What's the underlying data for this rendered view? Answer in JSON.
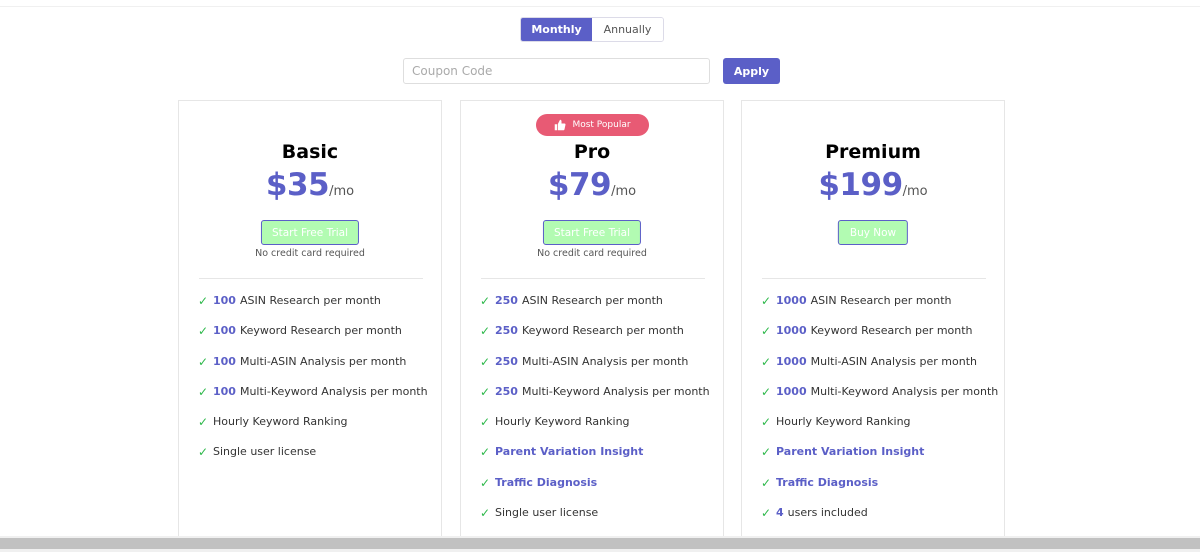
{
  "billing": {
    "options": [
      "Monthly",
      "Annually"
    ],
    "selected": "Monthly"
  },
  "coupon": {
    "placeholder": "Coupon Code",
    "value": "",
    "apply_label": "Apply"
  },
  "colors": {
    "accent": "#5b5fc7",
    "badge": "#e85a74",
    "cta_bg": "#b2fbb2",
    "check": "#2eb84b"
  },
  "plans": [
    {
      "name": "Basic",
      "price": "$35",
      "period": "/mo",
      "cta": "Start Free Trial",
      "note": "No credit card required",
      "features": [
        {
          "num": "100",
          "text": "ASIN Research per month",
          "highlight": false
        },
        {
          "num": "100",
          "text": "Keyword Research per month",
          "highlight": false
        },
        {
          "num": "100",
          "text": "Multi-ASIN Analysis per month",
          "highlight": false
        },
        {
          "num": "100",
          "text": "Multi-Keyword Analysis per month",
          "highlight": false
        },
        {
          "num": "",
          "text": "Hourly Keyword Ranking",
          "highlight": false
        },
        {
          "num": "",
          "text": "Single user license",
          "highlight": false
        }
      ]
    },
    {
      "name": "Pro",
      "badge": "Most Popular",
      "price": "$79",
      "period": "/mo",
      "cta": "Start Free Trial",
      "note": "No credit card required",
      "features": [
        {
          "num": "250",
          "text": "ASIN Research per month",
          "highlight": false
        },
        {
          "num": "250",
          "text": "Keyword Research per month",
          "highlight": false
        },
        {
          "num": "250",
          "text": "Multi-ASIN Analysis per month",
          "highlight": false
        },
        {
          "num": "250",
          "text": "Multi-Keyword Analysis per month",
          "highlight": false
        },
        {
          "num": "",
          "text": "Hourly Keyword Ranking",
          "highlight": false
        },
        {
          "num": "",
          "text": "Parent Variation Insight",
          "highlight": true
        },
        {
          "num": "",
          "text": "Traffic Diagnosis",
          "highlight": true
        },
        {
          "num": "",
          "text": "Single user license",
          "highlight": false
        }
      ]
    },
    {
      "name": "Premium",
      "price": "$199",
      "period": "/mo",
      "cta": "Buy Now",
      "note": "",
      "features": [
        {
          "num": "1000",
          "text": "ASIN Research per month",
          "highlight": false
        },
        {
          "num": "1000",
          "text": "Keyword Research per month",
          "highlight": false
        },
        {
          "num": "1000",
          "text": "Multi-ASIN Analysis per month",
          "highlight": false
        },
        {
          "num": "1000",
          "text": "Multi-Keyword Analysis per month",
          "highlight": false
        },
        {
          "num": "",
          "text": "Hourly Keyword Ranking",
          "highlight": false
        },
        {
          "num": "",
          "text": "Parent Variation Insight",
          "highlight": true
        },
        {
          "num": "",
          "text": "Traffic Diagnosis",
          "highlight": true
        },
        {
          "num": "4",
          "text": "users included",
          "highlight": false
        }
      ]
    }
  ],
  "icons": {
    "check": "✓",
    "badge": "thumbs-up-icon"
  }
}
